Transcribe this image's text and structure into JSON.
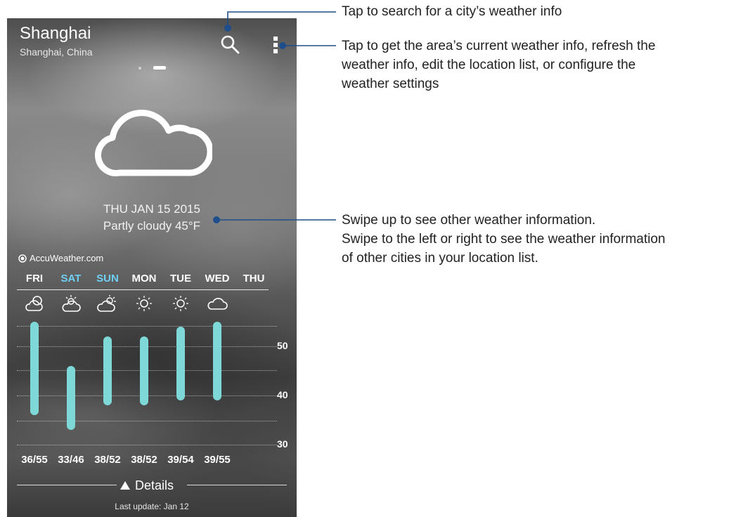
{
  "header": {
    "city": "Shanghai",
    "region": "Shanghai, China"
  },
  "icons": {
    "search": "search-icon",
    "menu": "more-vert-icon",
    "current": "cloud-icon"
  },
  "current": {
    "date": "THU JAN 15 2015",
    "condition": "Partly cloudy 45°F"
  },
  "provider": "AccuWeather.com",
  "forecast": {
    "days": [
      {
        "label": "FRI",
        "weekend": false,
        "icon": "partly-cloudy-icon",
        "temps": "36/55",
        "low": 36,
        "high": 55
      },
      {
        "label": "SAT",
        "weekend": true,
        "icon": "cloudy-sun-icon",
        "temps": "33/46",
        "low": 33,
        "high": 46
      },
      {
        "label": "SUN",
        "weekend": true,
        "icon": "cloudy-sun-icon",
        "temps": "38/52",
        "low": 38,
        "high": 52
      },
      {
        "label": "MON",
        "weekend": false,
        "icon": "sunny-icon",
        "temps": "38/52",
        "low": 38,
        "high": 52
      },
      {
        "label": "TUE",
        "weekend": false,
        "icon": "sunny-icon",
        "temps": "39/54",
        "low": 39,
        "high": 54
      },
      {
        "label": "WED",
        "weekend": false,
        "icon": "cloud-icon",
        "temps": "39/55",
        "low": 39,
        "high": 55
      },
      {
        "label": "THU",
        "weekend": false,
        "icon": "",
        "temps": "",
        "low": null,
        "high": null
      }
    ],
    "scale_labels": [
      "50",
      "40",
      "30"
    ]
  },
  "footer": {
    "details": "Details",
    "last_update": "Last update: Jan 12"
  },
  "callouts": {
    "search": "Tap to search for a city’s weather info",
    "menu_line1": "Tap to get the area’s current weather info, refresh the",
    "menu_line2": "weather info, edit the location list, or configure the",
    "menu_line3": "weather settings",
    "swipe_line1": "Swipe up to see other weather information.",
    "swipe_line2": "Swipe to the left or right to see the weather information",
    "swipe_line3": "of other cities in your location list."
  },
  "colors": {
    "bar": "#7fd8d8",
    "weekend": "#6fd0f5",
    "callout_line": "#1f4e8c"
  }
}
